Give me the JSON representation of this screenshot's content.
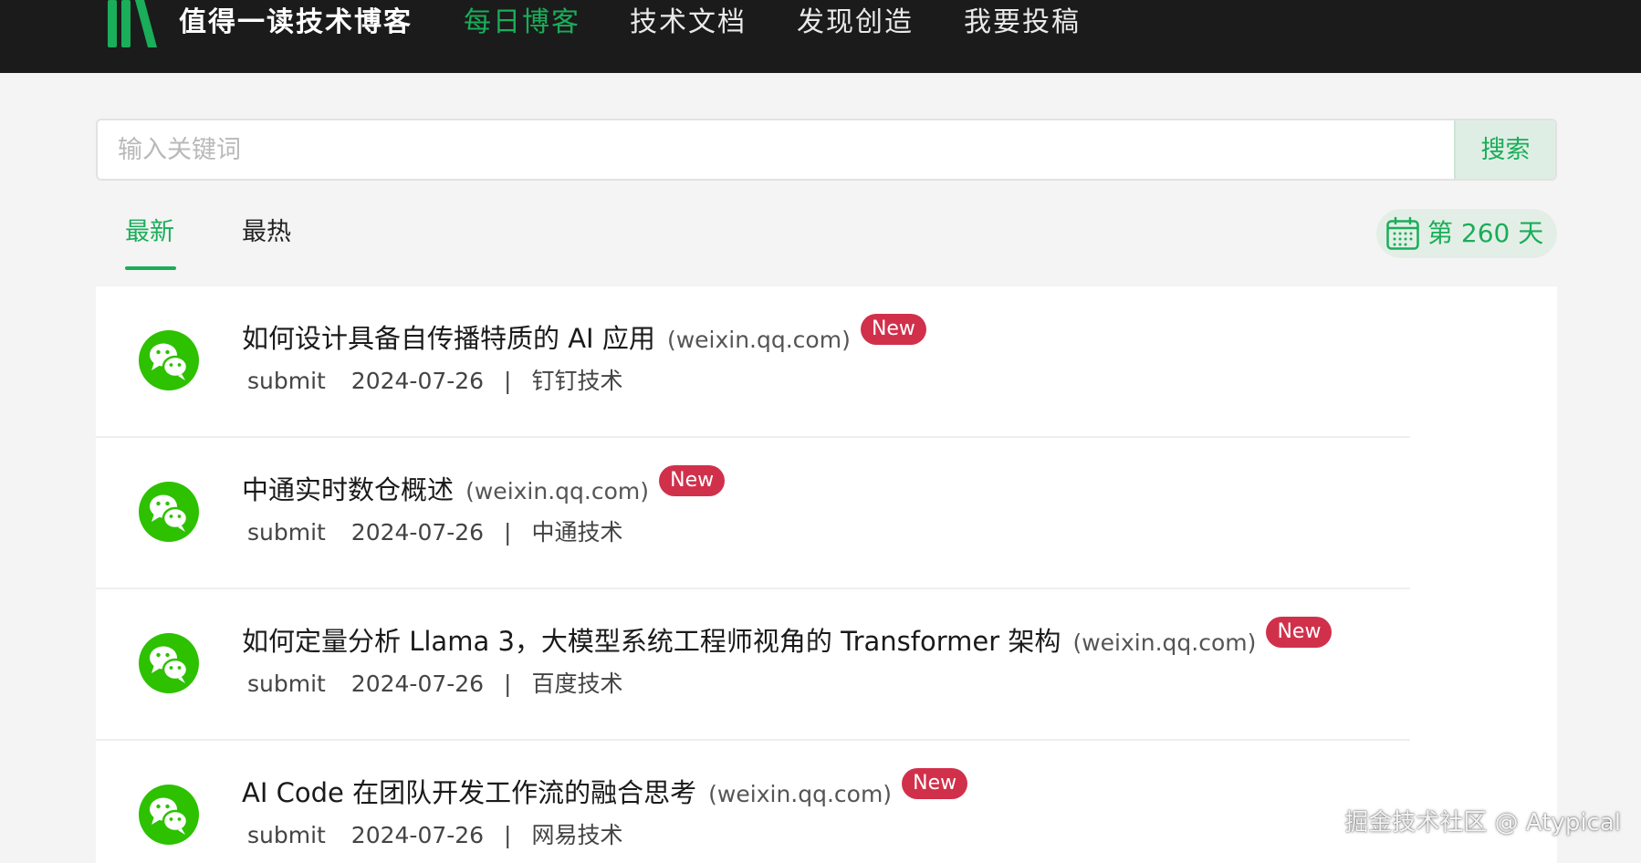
{
  "header": {
    "site_title": "值得一读技术博客",
    "nav": [
      {
        "label": "每日博客",
        "active": true
      },
      {
        "label": "技术文档",
        "active": false
      },
      {
        "label": "发现创造",
        "active": false
      },
      {
        "label": "我要投稿",
        "active": false
      }
    ]
  },
  "search": {
    "placeholder": "输入关键词",
    "value": "",
    "button_label": "搜索"
  },
  "tabs": [
    {
      "label": "最新",
      "active": true
    },
    {
      "label": "最热",
      "active": false
    }
  ],
  "day_badge": {
    "icon": "calendar-icon",
    "label": "第 260 天"
  },
  "articles": [
    {
      "icon": "wechat-icon",
      "title": "如何设计具备自传播特质的 AI 应用",
      "domain": "(weixin.qq.com)",
      "badge": "New",
      "submitter": "submit",
      "date": "2024-07-26",
      "separator": "|",
      "source": "钉钉技术"
    },
    {
      "icon": "wechat-icon",
      "title": "中通实时数仓概述",
      "domain": "(weixin.qq.com)",
      "badge": "New",
      "submitter": "submit",
      "date": "2024-07-26",
      "separator": "|",
      "source": "中通技术"
    },
    {
      "icon": "wechat-icon",
      "title": "如何定量分析 Llama 3，大模型系统工程师视角的 Transformer 架构",
      "domain": "(weixin.qq.com)",
      "badge": "New",
      "submitter": "submit",
      "date": "2024-07-26",
      "separator": "|",
      "source": "百度技术"
    },
    {
      "icon": "wechat-icon",
      "title": "AI Code 在团队开发工作流的融合思考",
      "domain": "(weixin.qq.com)",
      "badge": "New",
      "submitter": "submit",
      "date": "2024-07-26",
      "separator": "|",
      "source": "网易技术"
    }
  ],
  "watermark": "掘金技术社区 @ Atypical",
  "colors": {
    "brand_green": "#1aad5a",
    "new_badge": "#d1304b",
    "topbar": "#1b1b1b",
    "wechat_green": "#2dc100"
  }
}
